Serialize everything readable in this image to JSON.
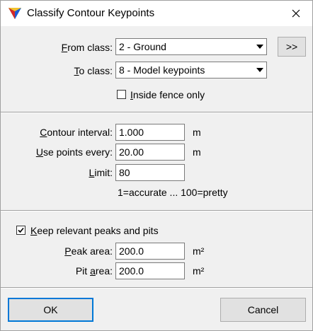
{
  "window": {
    "title": "Classify Contour Keypoints"
  },
  "classes": {
    "from_label_key": "F",
    "from_label_rest": "rom class:",
    "from_value": "2 - Ground",
    "to_label_key": "T",
    "to_label_rest": "o class:",
    "to_value": "8 - Model keypoints",
    "more_label": ">>",
    "inside_fence_key": "I",
    "inside_fence_rest": "nside fence only",
    "inside_fence_checked": false
  },
  "contour": {
    "interval_label_key": "C",
    "interval_label_rest": "ontour interval:",
    "interval_value": "1.000",
    "interval_unit": "m",
    "points_label_key": "U",
    "points_label_rest": "se points every:",
    "points_value": "20.00",
    "points_unit": "m",
    "limit_label_key": "L",
    "limit_label_rest": "imit:",
    "limit_value": "80",
    "hint": "1=accurate ... 100=pretty"
  },
  "peaks": {
    "keep_label_key": "K",
    "keep_label_rest": "eep relevant peaks and pits",
    "keep_checked": true,
    "peak_label_key": "P",
    "peak_label_rest": "eak area:",
    "peak_value": "200.0",
    "peak_unit": "m²",
    "pit_label_pre": "Pit ",
    "pit_label_key": "a",
    "pit_label_rest": "rea:",
    "pit_value": "200.0",
    "pit_unit": "m²"
  },
  "buttons": {
    "ok": "OK",
    "cancel": "Cancel"
  },
  "colors": {
    "accent": "#0078d7",
    "separator": "#a0a0a0"
  },
  "icons": {
    "app": "terrain-triangle-icon",
    "close": "close-icon",
    "dropdown": "chevron-down-icon",
    "check": "checkmark-icon"
  }
}
